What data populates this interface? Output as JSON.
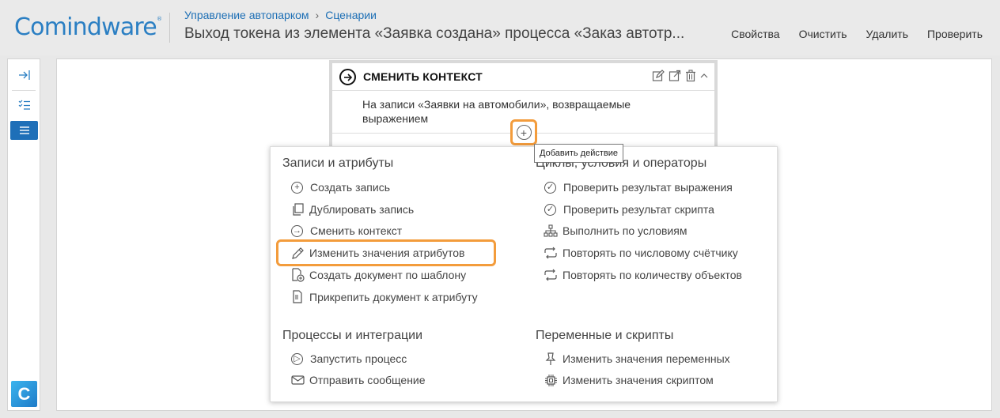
{
  "header": {
    "logo": "Comindware",
    "logo_mark": "®",
    "breadcrumb": [
      "Управление автопарком",
      "Сценарии"
    ],
    "title": "Выход токена из элемента «Заявка создана» процесса «Заказ автотр...",
    "actions": [
      "Свойства",
      "Очистить",
      "Удалить",
      "Проверить"
    ]
  },
  "leftbar": {
    "icons": [
      "collapse-icon",
      "checklist-icon",
      "list-icon"
    ],
    "app_logo": "C"
  },
  "card": {
    "title": "СМЕНИТЬ КОНТЕКСТ",
    "body": "На записи «Заявки на автомобили», возвращаемые выражением",
    "tools": [
      "edit-icon",
      "open-external-icon",
      "delete-icon",
      "collapse-icon"
    ]
  },
  "add_action": {
    "tooltip": "Добавить действие"
  },
  "menu": {
    "groups": [
      {
        "title": "Записи и атрибуты",
        "items": [
          {
            "label": "Создать запись",
            "icon": "plus-circle-icon"
          },
          {
            "label": "Дублировать запись",
            "icon": "duplicate-icon"
          },
          {
            "label": "Сменить контекст",
            "icon": "arrow-circle-icon"
          },
          {
            "label": "Изменить значения атрибутов",
            "icon": "pencil-icon"
          },
          {
            "label": "Создать документ по шаблону",
            "icon": "document-add-icon"
          },
          {
            "label": "Прикрепить документ к атрибуту",
            "icon": "document-attach-icon"
          }
        ]
      },
      {
        "title": "Циклы, условия и операторы",
        "items": [
          {
            "label": "Проверить результат выражения",
            "icon": "check-circle-icon"
          },
          {
            "label": "Проверить результат скрипта",
            "icon": "check-circle-icon"
          },
          {
            "label": "Выполнить по условиям",
            "icon": "hierarchy-icon"
          },
          {
            "label": "Повторять по числовому счётчику",
            "icon": "repeat-icon"
          },
          {
            "label": "Повторять по количеству объектов",
            "icon": "repeat-icon"
          }
        ]
      },
      {
        "title": "Процессы и интеграции",
        "items": [
          {
            "label": "Запустить процесс",
            "icon": "play-circle-icon"
          },
          {
            "label": "Отправить сообщение",
            "icon": "envelope-icon"
          }
        ]
      },
      {
        "title": "Переменные и скрипты",
        "items": [
          {
            "label": "Изменить значения переменных",
            "icon": "pin-icon"
          },
          {
            "label": "Изменить значения скриптом",
            "icon": "chip-icon"
          }
        ]
      }
    ]
  },
  "colors": {
    "accent": "#1e6fb8",
    "highlight": "#f39c3c"
  }
}
